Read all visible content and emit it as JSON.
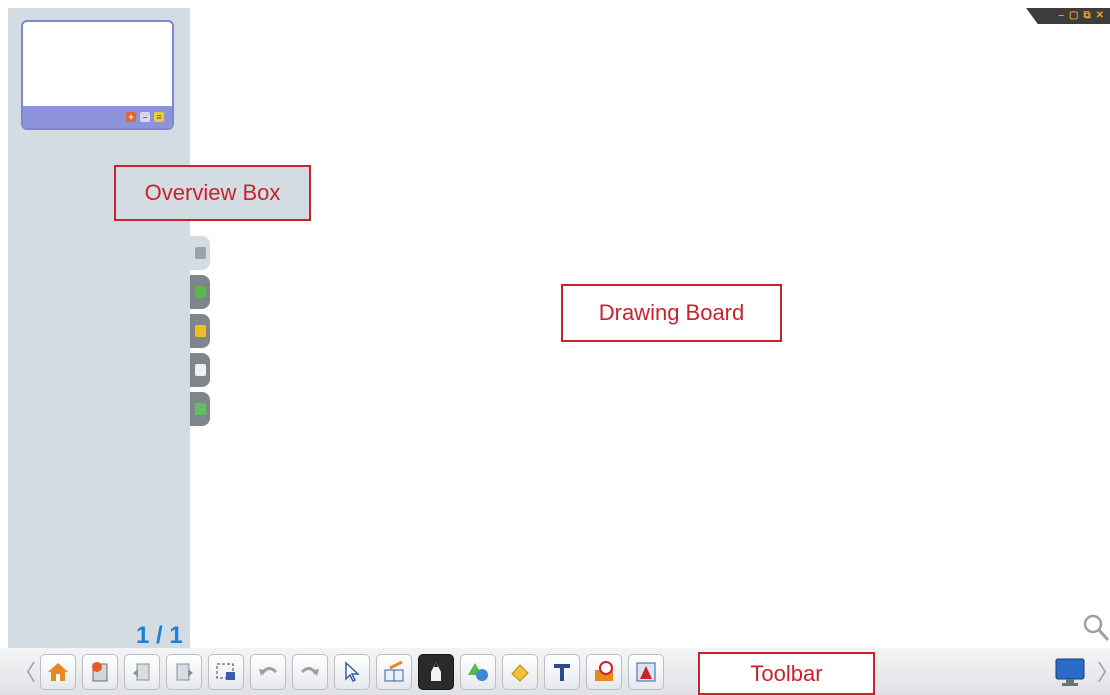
{
  "window_controls": {
    "minimize": "–",
    "restore": "▢",
    "maximize": "⧉",
    "close": "✕"
  },
  "overview": {
    "page_indicator": "1 / 1",
    "thumbnail_buttons": {
      "add": "+",
      "remove": "–",
      "menu": "≡"
    }
  },
  "side_tabs": [
    "pages-icon",
    "gallery-icon",
    "toolbox-icon",
    "comment-icon",
    "attachment-icon"
  ],
  "annotations": {
    "overview_box": "Overview Box",
    "drawing_board": "Drawing Board",
    "toolbar": "Toolbar"
  },
  "toolbar": {
    "nav_left": "〈",
    "nav_right": "〉",
    "tools": [
      "home-icon",
      "new-page-icon",
      "prev-page-icon",
      "next-page-icon",
      "screen-capture-icon",
      "undo-icon",
      "redo-icon",
      "select-icon",
      "handwriting-recognition-icon",
      "pen-icon",
      "shapes-icon",
      "eraser-icon",
      "text-icon",
      "tools-box-icon",
      "background-icon"
    ]
  },
  "colors": {
    "accent_blue": "#1e7fd8",
    "annotation_red": "#c8232c",
    "sidebar": "#d3dce2",
    "thumbnail_border": "#8d93db"
  }
}
